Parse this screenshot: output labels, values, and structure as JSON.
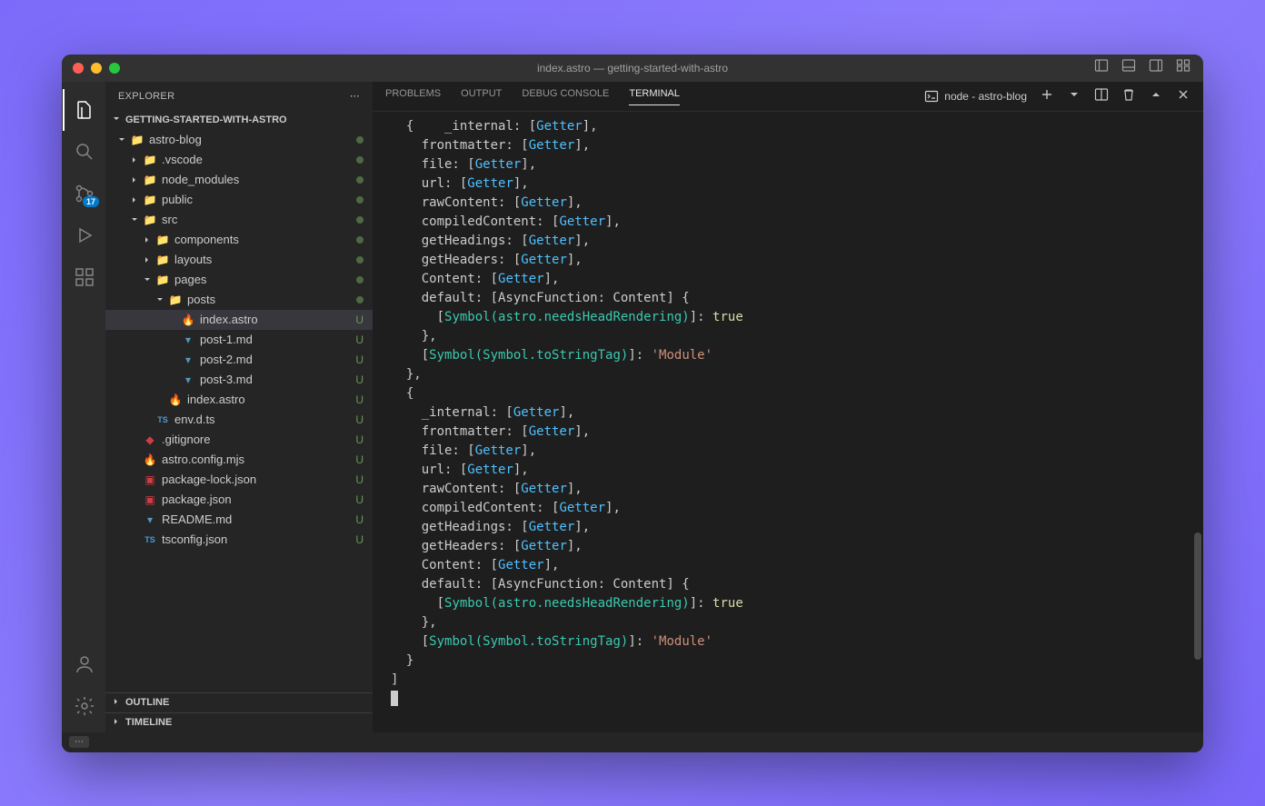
{
  "title": "index.astro — getting-started-with-astro",
  "explorer": {
    "label": "EXPLORER",
    "project": "GETTING-STARTED-WITH-ASTRO",
    "outline": "OUTLINE",
    "timeline": "TIMELINE"
  },
  "scm_badge": "17",
  "tree": [
    {
      "d": 0,
      "exp": true,
      "icon": "folder-g",
      "label": "astro-blog",
      "st": "dot"
    },
    {
      "d": 1,
      "exp": false,
      "icon": "folder-b",
      "label": ".vscode",
      "st": "dot"
    },
    {
      "d": 1,
      "exp": false,
      "icon": "folder-g2",
      "label": "node_modules",
      "st": "dot"
    },
    {
      "d": 1,
      "exp": false,
      "icon": "folder-g",
      "label": "public",
      "st": "dot"
    },
    {
      "d": 1,
      "exp": true,
      "icon": "folder-g",
      "label": "src",
      "st": "dot"
    },
    {
      "d": 2,
      "exp": false,
      "icon": "folder-y",
      "label": "components",
      "st": "dot"
    },
    {
      "d": 2,
      "exp": false,
      "icon": "folder-r",
      "label": "layouts",
      "st": "dot"
    },
    {
      "d": 2,
      "exp": true,
      "icon": "folder-y2",
      "label": "pages",
      "st": "dot"
    },
    {
      "d": 3,
      "exp": true,
      "icon": "folder-p",
      "label": "posts",
      "st": "dot"
    },
    {
      "d": 4,
      "icon": "astro",
      "label": "index.astro",
      "st": "U",
      "sel": true
    },
    {
      "d": 4,
      "icon": "md",
      "label": "post-1.md",
      "st": "U"
    },
    {
      "d": 4,
      "icon": "md",
      "label": "post-2.md",
      "st": "U"
    },
    {
      "d": 4,
      "icon": "md",
      "label": "post-3.md",
      "st": "U"
    },
    {
      "d": 3,
      "icon": "astro",
      "label": "index.astro",
      "st": "U"
    },
    {
      "d": 2,
      "icon": "ts",
      "label": "env.d.ts",
      "st": "U"
    },
    {
      "d": 1,
      "icon": "git",
      "label": ".gitignore",
      "st": "U"
    },
    {
      "d": 1,
      "icon": "astro",
      "label": "astro.config.mjs",
      "st": "U"
    },
    {
      "d": 1,
      "icon": "npm",
      "label": "package-lock.json",
      "st": "U"
    },
    {
      "d": 1,
      "icon": "npm",
      "label": "package.json",
      "st": "U"
    },
    {
      "d": 1,
      "icon": "md2",
      "label": "README.md",
      "st": "U"
    },
    {
      "d": 1,
      "icon": "ts",
      "label": "tsconfig.json",
      "st": "U"
    }
  ],
  "panelTabs": {
    "problems": "PROBLEMS",
    "output": "OUTPUT",
    "debug": "DEBUG CONSOLE",
    "terminal": "TERMINAL"
  },
  "terminalLabel": "node - astro-blog",
  "term_tokens": [
    [
      "  {",
      ""
    ],
    [
      "    _internal: ",
      ""
    ],
    [
      "[",
      ""
    ],
    [
      "Getter",
      "c"
    ],
    [
      "],",
      ""
    ],
    [
      "\n",
      ""
    ],
    [
      "    frontmatter: ",
      ""
    ],
    [
      "[",
      ""
    ],
    [
      "Getter",
      "c"
    ],
    [
      "],",
      ""
    ],
    [
      "\n",
      ""
    ],
    [
      "    file: ",
      ""
    ],
    [
      "[",
      ""
    ],
    [
      "Getter",
      "c"
    ],
    [
      "],",
      ""
    ],
    [
      "\n",
      ""
    ],
    [
      "    url: ",
      ""
    ],
    [
      "[",
      ""
    ],
    [
      "Getter",
      "c"
    ],
    [
      "],",
      ""
    ],
    [
      "\n",
      ""
    ],
    [
      "    rawContent: ",
      ""
    ],
    [
      "[",
      ""
    ],
    [
      "Getter",
      "c"
    ],
    [
      "],",
      ""
    ],
    [
      "\n",
      ""
    ],
    [
      "    compiledContent: ",
      ""
    ],
    [
      "[",
      ""
    ],
    [
      "Getter",
      "c"
    ],
    [
      "],",
      ""
    ],
    [
      "\n",
      ""
    ],
    [
      "    getHeadings: ",
      ""
    ],
    [
      "[",
      ""
    ],
    [
      "Getter",
      "c"
    ],
    [
      "],",
      ""
    ],
    [
      "\n",
      ""
    ],
    [
      "    getHeaders: ",
      ""
    ],
    [
      "[",
      ""
    ],
    [
      "Getter",
      "c"
    ],
    [
      "],",
      ""
    ],
    [
      "\n",
      ""
    ],
    [
      "    Content: ",
      ""
    ],
    [
      "[",
      ""
    ],
    [
      "Getter",
      "c"
    ],
    [
      "],",
      ""
    ],
    [
      "\n",
      ""
    ],
    [
      "    default: [AsyncFunction: Content] {",
      ""
    ],
    [
      "\n",
      ""
    ],
    [
      "      [",
      ""
    ],
    [
      "Symbol(astro.needsHeadRendering)",
      "s"
    ],
    [
      "]: ",
      ""
    ],
    [
      "true",
      "y"
    ],
    [
      "\n",
      ""
    ],
    [
      "    },",
      ""
    ],
    [
      "\n",
      ""
    ],
    [
      "    [",
      ""
    ],
    [
      "Symbol(Symbol.toStringTag)",
      "s"
    ],
    [
      "]: ",
      ""
    ],
    [
      "'Module'",
      "o"
    ],
    [
      "\n",
      ""
    ],
    [
      "  },",
      ""
    ],
    [
      "\n",
      ""
    ],
    [
      "  {",
      ""
    ],
    [
      "\n",
      ""
    ],
    [
      "    _internal: ",
      ""
    ],
    [
      "[",
      ""
    ],
    [
      "Getter",
      "c"
    ],
    [
      "],",
      ""
    ],
    [
      "\n",
      ""
    ],
    [
      "    frontmatter: ",
      ""
    ],
    [
      "[",
      ""
    ],
    [
      "Getter",
      "c"
    ],
    [
      "],",
      ""
    ],
    [
      "\n",
      ""
    ],
    [
      "    file: ",
      ""
    ],
    [
      "[",
      ""
    ],
    [
      "Getter",
      "c"
    ],
    [
      "],",
      ""
    ],
    [
      "\n",
      ""
    ],
    [
      "    url: ",
      ""
    ],
    [
      "[",
      ""
    ],
    [
      "Getter",
      "c"
    ],
    [
      "],",
      ""
    ],
    [
      "\n",
      ""
    ],
    [
      "    rawContent: ",
      ""
    ],
    [
      "[",
      ""
    ],
    [
      "Getter",
      "c"
    ],
    [
      "],",
      ""
    ],
    [
      "\n",
      ""
    ],
    [
      "    compiledContent: ",
      ""
    ],
    [
      "[",
      ""
    ],
    [
      "Getter",
      "c"
    ],
    [
      "],",
      ""
    ],
    [
      "\n",
      ""
    ],
    [
      "    getHeadings: ",
      ""
    ],
    [
      "[",
      ""
    ],
    [
      "Getter",
      "c"
    ],
    [
      "],",
      ""
    ],
    [
      "\n",
      ""
    ],
    [
      "    getHeaders: ",
      ""
    ],
    [
      "[",
      ""
    ],
    [
      "Getter",
      "c"
    ],
    [
      "],",
      ""
    ],
    [
      "\n",
      ""
    ],
    [
      "    Content: ",
      ""
    ],
    [
      "[",
      ""
    ],
    [
      "Getter",
      "c"
    ],
    [
      "],",
      ""
    ],
    [
      "\n",
      ""
    ],
    [
      "    default: [AsyncFunction: Content] {",
      ""
    ],
    [
      "\n",
      ""
    ],
    [
      "      [",
      ""
    ],
    [
      "Symbol(astro.needsHeadRendering)",
      "s"
    ],
    [
      "]: ",
      ""
    ],
    [
      "true",
      "y"
    ],
    [
      "\n",
      ""
    ],
    [
      "    },",
      ""
    ],
    [
      "\n",
      ""
    ],
    [
      "    [",
      ""
    ],
    [
      "Symbol(Symbol.toStringTag)",
      "s"
    ],
    [
      "]: ",
      ""
    ],
    [
      "'Module'",
      "o"
    ],
    [
      "\n",
      ""
    ],
    [
      "  }",
      ""
    ],
    [
      "\n",
      ""
    ],
    [
      "]",
      ""
    ]
  ]
}
